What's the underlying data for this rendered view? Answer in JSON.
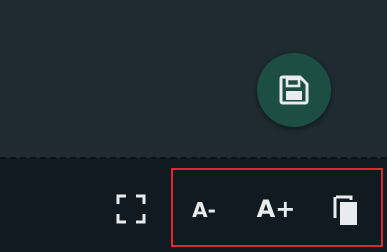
{
  "toolbar": {
    "save_icon": "save-icon",
    "expand_icon": "expand-icon",
    "font_decrease_label": "A-",
    "font_increase_label": "A+",
    "copy_icon": "copy-icon"
  },
  "colors": {
    "editor_bg": "#1f2b31",
    "toolbar_bg": "#111a20",
    "fab_bg": "#1d4e43",
    "highlight": "#e3262d",
    "icon": "#e8ecef"
  }
}
